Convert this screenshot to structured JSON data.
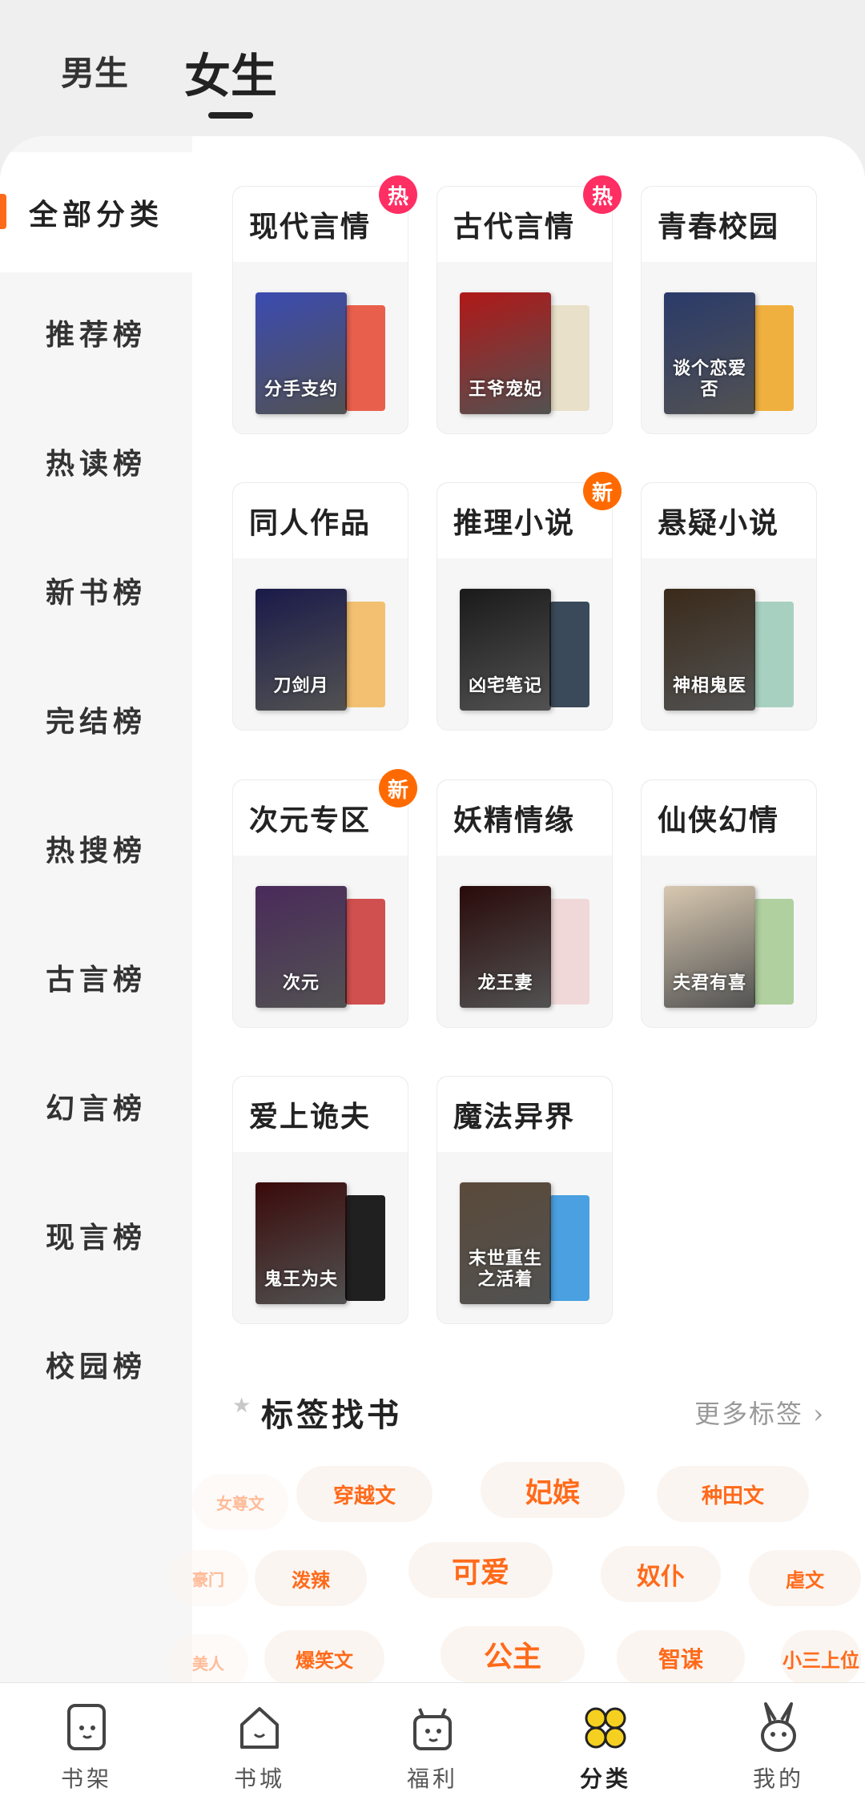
{
  "top_tabs": {
    "male": "男生",
    "female": "女生"
  },
  "sidebar": {
    "items": [
      {
        "label": "全部分类",
        "active": true
      },
      {
        "label": "推荐榜"
      },
      {
        "label": "热读榜"
      },
      {
        "label": "新书榜"
      },
      {
        "label": "完结榜"
      },
      {
        "label": "热搜榜"
      },
      {
        "label": "古言榜"
      },
      {
        "label": "幻言榜"
      },
      {
        "label": "现言榜"
      },
      {
        "label": "校园榜"
      }
    ]
  },
  "categories": [
    {
      "title": "现代言情",
      "badge": "热",
      "badge_type": "hot",
      "cover_text": "分手支约",
      "front_color": "#3b4bb0",
      "back_color": "#e8604c"
    },
    {
      "title": "古代言情",
      "badge": "热",
      "badge_type": "hot",
      "cover_text": "王爷宠妃",
      "front_color": "#b01818",
      "back_color": "#e8e0c8"
    },
    {
      "title": "青春校园",
      "badge": "",
      "badge_type": "",
      "cover_text": "谈个恋爱否",
      "front_color": "#2a3a6a",
      "back_color": "#f0b040"
    },
    {
      "title": "同人作品",
      "badge": "",
      "badge_type": "",
      "cover_text": "刀剑月",
      "front_color": "#1a1a4a",
      "back_color": "#f2c070"
    },
    {
      "title": "推理小说",
      "badge": "新",
      "badge_type": "new",
      "cover_text": "凶宅笔记",
      "front_color": "#1a1a1a",
      "back_color": "#3a4a5a"
    },
    {
      "title": "悬疑小说",
      "badge": "",
      "badge_type": "",
      "cover_text": "神相鬼医",
      "front_color": "#3a2a1a",
      "back_color": "#a8d0c0"
    },
    {
      "title": "次元专区",
      "badge": "新",
      "badge_type": "new",
      "cover_text": "次元",
      "front_color": "#4a2a5a",
      "back_color": "#d05050"
    },
    {
      "title": "妖精情缘",
      "badge": "",
      "badge_type": "",
      "cover_text": "龙王妻",
      "front_color": "#2a0a0a",
      "back_color": "#f0d8d8"
    },
    {
      "title": "仙侠幻情",
      "badge": "",
      "badge_type": "",
      "cover_text": "夫君有喜",
      "front_color": "#d8c8b0",
      "back_color": "#b0d0a0"
    },
    {
      "title": "爱上诡夫",
      "badge": "",
      "badge_type": "",
      "cover_text": "鬼王为夫",
      "front_color": "#3a0a0a",
      "back_color": "#202020"
    },
    {
      "title": "魔法异界",
      "badge": "",
      "badge_type": "",
      "cover_text": "末世重生之活着",
      "front_color": "#5a4a3a",
      "back_color": "#4aa0e0"
    }
  ],
  "tags_section": {
    "title": "标签找书",
    "more": "更多标签"
  },
  "tags": [
    {
      "text": "女尊文",
      "size": 20,
      "faded": true
    },
    {
      "text": "穿越文",
      "size": 26,
      "faded": false
    },
    {
      "text": "妃嫔",
      "size": 34,
      "faded": false
    },
    {
      "text": "种田文",
      "size": 26,
      "faded": false
    },
    {
      "text": "豪门",
      "size": 20,
      "faded": true
    },
    {
      "text": "泼辣",
      "size": 24,
      "faded": false
    },
    {
      "text": "可爱",
      "size": 36,
      "faded": false
    },
    {
      "text": "奴仆",
      "size": 30,
      "faded": false
    },
    {
      "text": "虐文",
      "size": 24,
      "faded": false
    },
    {
      "text": "美人",
      "size": 20,
      "faded": true
    },
    {
      "text": "爆笑文",
      "size": 24,
      "faded": false
    },
    {
      "text": "公主",
      "size": 36,
      "faded": false
    },
    {
      "text": "智谋",
      "size": 28,
      "faded": false
    },
    {
      "text": "小三上位",
      "size": 24,
      "faded": false
    }
  ],
  "bottom_nav": [
    {
      "label": "书架",
      "icon": "bookshelf-icon"
    },
    {
      "label": "书城",
      "icon": "bookstore-icon"
    },
    {
      "label": "福利",
      "icon": "gift-icon"
    },
    {
      "label": "分类",
      "icon": "category-icon",
      "active": true
    },
    {
      "label": "我的",
      "icon": "profile-icon"
    }
  ]
}
